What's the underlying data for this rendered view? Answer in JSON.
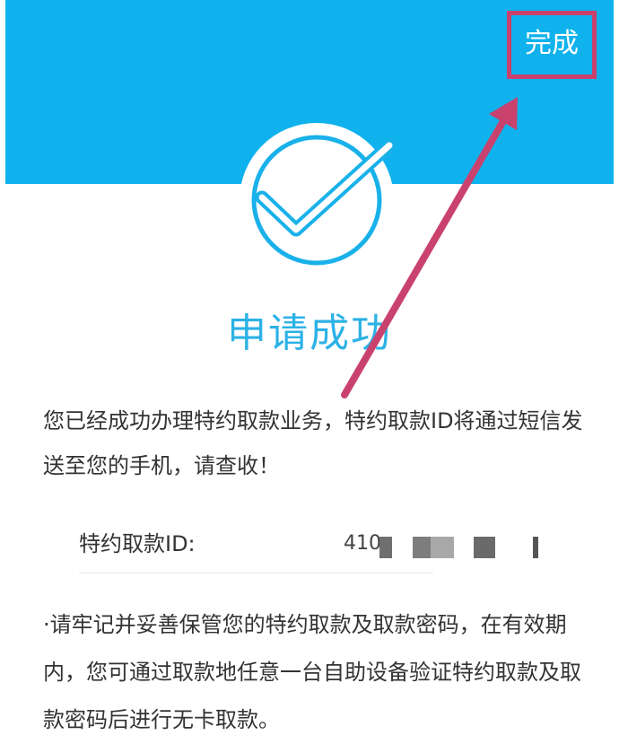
{
  "header": {
    "done_label": "完成"
  },
  "status": {
    "icon": "check-circle-icon",
    "title": "申请成功"
  },
  "message": {
    "text": "您已经成功办理特约取款业务，特约取款ID将通过短信发送至您的手机，请查收！"
  },
  "withdrawal_id": {
    "label": "特约取款ID:",
    "value_visible_prefix": "410"
  },
  "notice": {
    "text": "·请牢记并妥善保管您的特约取款及取款密码，在有效期内，您可通过取款地任意一台自助设备验证特约取款及取款密码后进行无卡取款。"
  },
  "colors": {
    "brand": "#0fb2ec",
    "title": "#2cb2e6",
    "annotation": "#c9426e",
    "text": "#333333"
  }
}
